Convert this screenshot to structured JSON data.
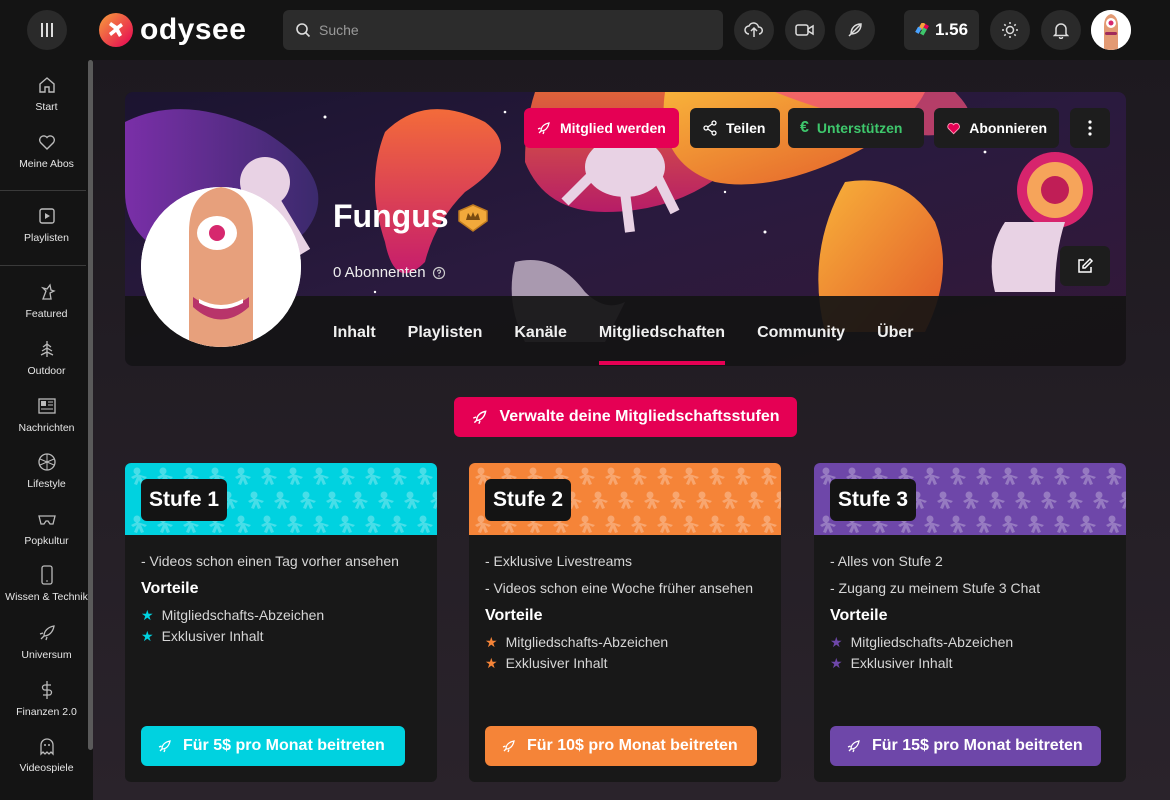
{
  "header": {
    "logo_text": "odysee",
    "search_placeholder": "Suche",
    "wallet_balance": "1.56"
  },
  "sidebar": {
    "items": [
      {
        "label": "Start",
        "icon": "home-icon"
      },
      {
        "label": "Meine Abos",
        "icon": "heart-icon"
      },
      {
        "label": "Playlisten",
        "icon": "playlist-icon"
      },
      {
        "label": "Featured",
        "icon": "featured-icon"
      },
      {
        "label": "Outdoor",
        "icon": "tree-icon"
      },
      {
        "label": "Nachrichten",
        "icon": "news-icon"
      },
      {
        "label": "Lifestyle",
        "icon": "lifestyle-icon"
      },
      {
        "label": "Popkultur",
        "icon": "popculture-icon"
      },
      {
        "label": "Wissen & Technik",
        "icon": "phone-icon"
      },
      {
        "label": "Universum",
        "icon": "rocket-icon"
      },
      {
        "label": "Finanzen 2.0",
        "icon": "dollar-icon"
      },
      {
        "label": "Videospiele",
        "icon": "ghost-icon"
      }
    ]
  },
  "channel": {
    "name": "Fungus",
    "subscribers": "0 Abonnenten",
    "actions": {
      "member": "Mitglied werden",
      "share": "Teilen",
      "support": "Unterstützen",
      "subscribe": "Abonnieren"
    },
    "tabs": [
      "Inhalt",
      "Playlisten",
      "Kanäle",
      "Mitgliedschaften",
      "Community",
      "Über"
    ],
    "active_tab": "Mitgliedschaften"
  },
  "manage_button": "Verwalte deine Mitgliedschaftsstufen",
  "tiers": [
    {
      "title": "Stufe 1",
      "color": "#00d2e0",
      "lines": [
        "- Videos schon einen Tag vorher ansehen"
      ],
      "perks_heading": "Vorteile",
      "perks": [
        "Mitgliedschafts-Abzeichen",
        "Exklusiver Inhalt"
      ],
      "button": "Für 5$ pro Monat beitreten"
    },
    {
      "title": "Stufe 2",
      "color": "#f58438",
      "lines": [
        "- Exklusive Livestreams",
        "- Videos schon eine Woche früher ansehen"
      ],
      "perks_heading": "Vorteile",
      "perks": [
        "Mitgliedschafts-Abzeichen",
        "Exklusiver Inhalt"
      ],
      "button": "Für 10$ pro Monat beitreten"
    },
    {
      "title": "Stufe 3",
      "color": "#6e47a9",
      "lines": [
        "- Alles von Stufe 2",
        "- Zugang zu meinem Stufe 3 Chat"
      ],
      "perks_heading": "Vorteile",
      "perks": [
        "Mitgliedschafts-Abzeichen",
        "Exklusiver Inhalt"
      ],
      "button": "Für 15$ pro Monat beitreten"
    }
  ],
  "colors": {
    "accent": "#e50054",
    "support_green": "#3ec76c"
  }
}
